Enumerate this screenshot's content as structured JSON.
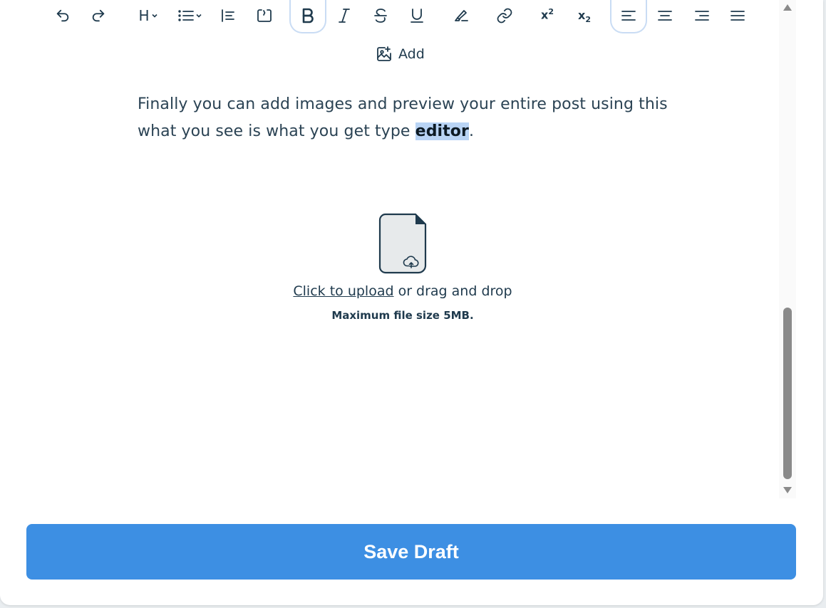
{
  "toolbar": {
    "heading_label": "H",
    "superscript_label": "x",
    "superscript_index": "2",
    "subscript_label": "x",
    "subscript_index": "2",
    "add_label": "Add",
    "active_buttons": [
      "bold",
      "align-left"
    ]
  },
  "editor": {
    "text_before": "Finally you can add images and preview your entire post using this what you see is what you get type ",
    "selected_word": "editor",
    "text_after": "."
  },
  "upload": {
    "link_text": "Click to upload",
    "rest_text": " or drag and drop",
    "note": "Maximum file size 5MB."
  },
  "save_button": {
    "label": "Save Draft"
  },
  "colors": {
    "accent": "#3d8fe3",
    "selection": "#b9d4f5",
    "text": "#1f3a4d"
  }
}
